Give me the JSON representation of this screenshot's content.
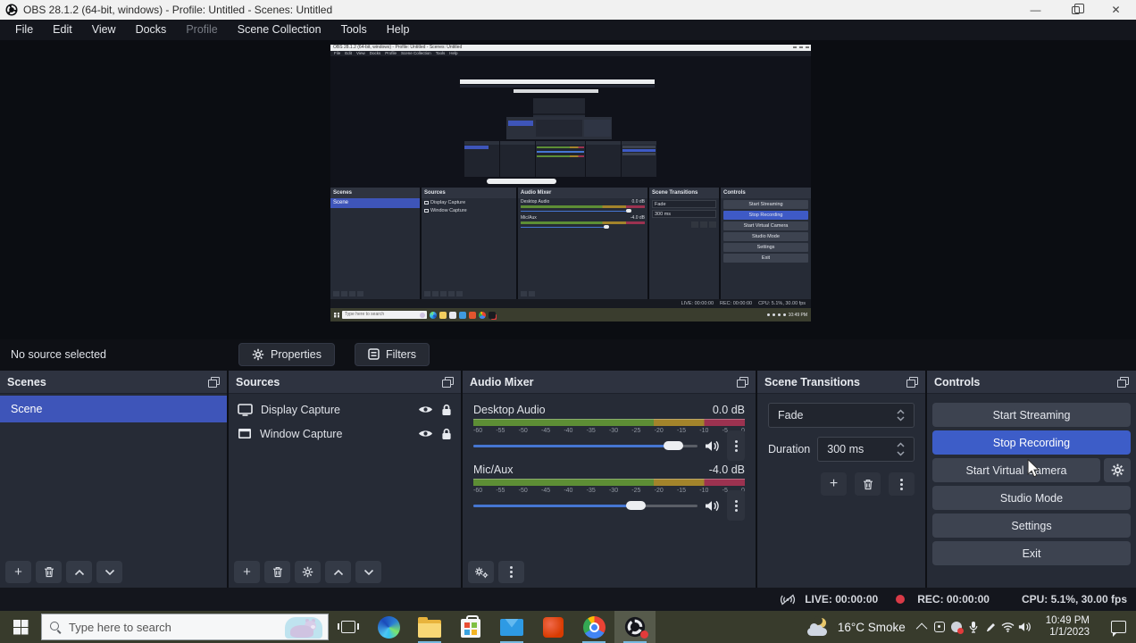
{
  "window": {
    "title": "OBS 28.1.2 (64-bit, windows) - Profile: Untitled - Scenes: Untitled"
  },
  "menu": {
    "items": [
      "File",
      "Edit",
      "View",
      "Docks",
      "Profile",
      "Scene Collection",
      "Tools",
      "Help"
    ]
  },
  "source_toolbar": {
    "status": "No source selected",
    "properties_label": "Properties",
    "filters_label": "Filters"
  },
  "panels": {
    "scenes": {
      "title": "Scenes",
      "items": [
        "Scene"
      ],
      "selected": "Scene"
    },
    "sources": {
      "title": "Sources",
      "items": [
        {
          "label": "Display Capture"
        },
        {
          "label": "Window Capture"
        }
      ]
    },
    "audio_mixer": {
      "title": "Audio Mixer",
      "scale": [
        "-60",
        "-55",
        "-50",
        "-45",
        "-40",
        "-35",
        "-30",
        "-25",
        "-20",
        "-15",
        "-10",
        "-5",
        "0"
      ],
      "channels": [
        {
          "name": "Desktop Audio",
          "level": "0.0 dB",
          "slider_pct": 93
        },
        {
          "name": "Mic/Aux",
          "level": "-4.0 dB",
          "slider_pct": 76
        }
      ]
    },
    "scene_transitions": {
      "title": "Scene Transitions",
      "transition": "Fade",
      "duration_label": "Duration",
      "duration_value": "300 ms"
    },
    "controls": {
      "title": "Controls",
      "buttons": [
        "Start Streaming",
        "Stop Recording",
        "Start Virtual Camera",
        "Studio Mode",
        "Settings",
        "Exit"
      ],
      "active_button": "Stop Recording"
    }
  },
  "status_bar": {
    "live": "LIVE: 00:00:00",
    "rec": "REC: 00:00:00",
    "cpu": "CPU: 5.1%, 30.00 fps"
  },
  "taskbar": {
    "search_placeholder": "Type here to search",
    "apps": [
      "edge",
      "file-explorer",
      "store",
      "mail",
      "office",
      "chrome",
      "obs-studio"
    ],
    "tray": {
      "weather": "16°C Smoke",
      "time": "10:49 PM",
      "date": "1/1/2023"
    }
  },
  "colors": {
    "accent_blue": "#3d5dc8",
    "scene_selected_blue": "#3e55b9",
    "meter_green": "#5d8e35",
    "meter_yellow": "#a3842b",
    "meter_red": "#9c3250",
    "record_red": "#d93a47",
    "taskbar_olive": "#383b2c"
  }
}
